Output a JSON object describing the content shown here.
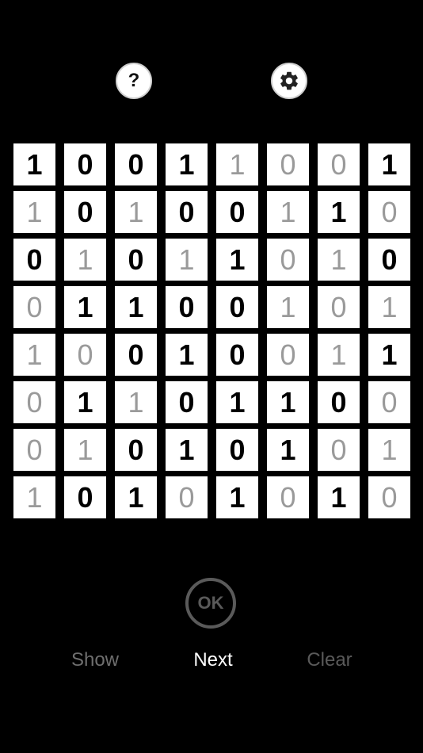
{
  "header": {
    "help_label": "?",
    "settings_icon": "gear-icon"
  },
  "grid": {
    "rows": [
      [
        "1",
        "0",
        "0",
        "1",
        "1",
        "0",
        "0",
        "1"
      ],
      [
        "1",
        "0",
        "1",
        "0",
        "0",
        "1",
        "1",
        "0"
      ],
      [
        "0",
        "1",
        "0",
        "1",
        "1",
        "0",
        "1",
        "0"
      ],
      [
        "0",
        "1",
        "1",
        "0",
        "0",
        "1",
        "0",
        "1"
      ],
      [
        "1",
        "0",
        "0",
        "1",
        "0",
        "0",
        "1",
        "1"
      ],
      [
        "0",
        "1",
        "1",
        "0",
        "1",
        "1",
        "0",
        "0"
      ],
      [
        "0",
        "1",
        "0",
        "1",
        "0",
        "1",
        "0",
        "1"
      ],
      [
        "1",
        "0",
        "1",
        "0",
        "1",
        "0",
        "1",
        "0"
      ]
    ],
    "states": [
      [
        "f",
        "f",
        "f",
        "f",
        "u",
        "u",
        "u",
        "f"
      ],
      [
        "u",
        "f",
        "u",
        "f",
        "f",
        "u",
        "f",
        "u"
      ],
      [
        "f",
        "u",
        "f",
        "u",
        "f",
        "u",
        "u",
        "f"
      ],
      [
        "u",
        "f",
        "f",
        "f",
        "f",
        "u",
        "u",
        "u"
      ],
      [
        "u",
        "u",
        "f",
        "f",
        "f",
        "u",
        "u",
        "f"
      ],
      [
        "u",
        "f",
        "u",
        "f",
        "f",
        "f",
        "f",
        "u"
      ],
      [
        "u",
        "u",
        "f",
        "f",
        "f",
        "f",
        "u",
        "u"
      ],
      [
        "u",
        "f",
        "f",
        "u",
        "f",
        "u",
        "f",
        "u"
      ]
    ],
    "colors": {
      "fixed": "#000000",
      "user": "#9a9a9a",
      "cell_bg": "#ffffff"
    }
  },
  "controls": {
    "ok_label": "OK",
    "show_label": "Show",
    "next_label": "Next",
    "clear_label": "Clear"
  }
}
